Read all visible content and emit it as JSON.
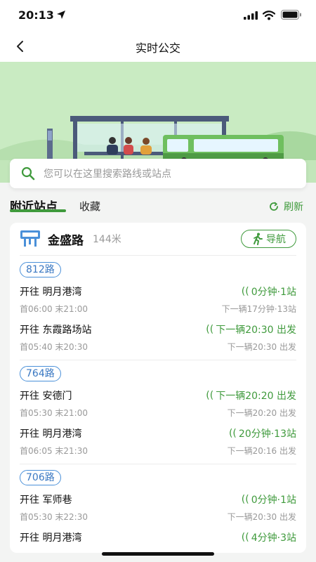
{
  "status_bar": {
    "time": "20:13"
  },
  "nav": {
    "title": "实时公交"
  },
  "search": {
    "placeholder": "您可以在这里搜索路线或站点"
  },
  "tabs": {
    "nearby": "附近站点",
    "favorites": "收藏",
    "refresh": "刷新"
  },
  "stop": {
    "name": "金盛路",
    "distance": "144米",
    "navigate": "导航"
  },
  "routes": [
    {
      "name": "812路",
      "directions": [
        {
          "label": "开往 明月港湾",
          "hours": "首06:00 末21:00",
          "status": "0分钟·1站",
          "next": "下一辆17分钟·13站"
        },
        {
          "label": "开往 东霞路场站",
          "hours": "首05:40 末20:30",
          "status": "下一辆20:30 出发",
          "next": "下一辆20:30 出发"
        }
      ]
    },
    {
      "name": "764路",
      "directions": [
        {
          "label": "开往 安德门",
          "hours": "首05:30 末21:00",
          "status": "下一辆20:20 出发",
          "next": "下一辆20:20 出发"
        },
        {
          "label": "开往 明月港湾",
          "hours": "首06:05 末21:30",
          "status": "20分钟·13站",
          "next": "下一辆20:16 出发"
        }
      ]
    },
    {
      "name": "706路",
      "directions": [
        {
          "label": "开往 军师巷",
          "hours": "首05:30 末22:30",
          "status": "0分钟·1站",
          "next": "下一辆20:30 出发"
        },
        {
          "label": "开往 明月港湾",
          "hours": "",
          "status": "4分钟·3站",
          "next": ""
        }
      ]
    }
  ],
  "colors": {
    "accent": "#3f9a3c",
    "route_badge": "#4a90d9",
    "banner_bg": "#c9ebc2"
  }
}
